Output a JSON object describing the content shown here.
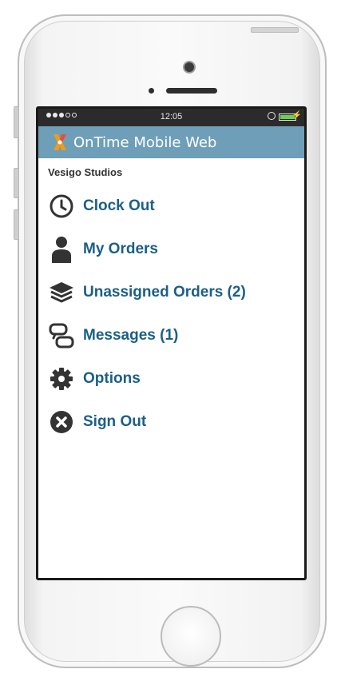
{
  "device": {
    "status_bar": {
      "time": "12:05",
      "battery_level": 1.0,
      "battery_color": "#6bd04b",
      "signal_bars_filled": 3,
      "signal_bars_total": 5
    }
  },
  "app": {
    "title": "OnTime Mobile Web",
    "header_color": "#6f9fb8",
    "company": "Vesigo Studios",
    "link_color": "#1b5f86",
    "menu": [
      {
        "label": "Clock Out",
        "icon": "clock-icon"
      },
      {
        "label": "My Orders",
        "icon": "person-icon"
      },
      {
        "label": "Unassigned Orders (2)",
        "icon": "layers-icon"
      },
      {
        "label": "Messages (1)",
        "icon": "chat-bubbles-icon"
      },
      {
        "label": "Options",
        "icon": "gear-icon"
      },
      {
        "label": "Sign Out",
        "icon": "close-circle-icon"
      }
    ]
  }
}
